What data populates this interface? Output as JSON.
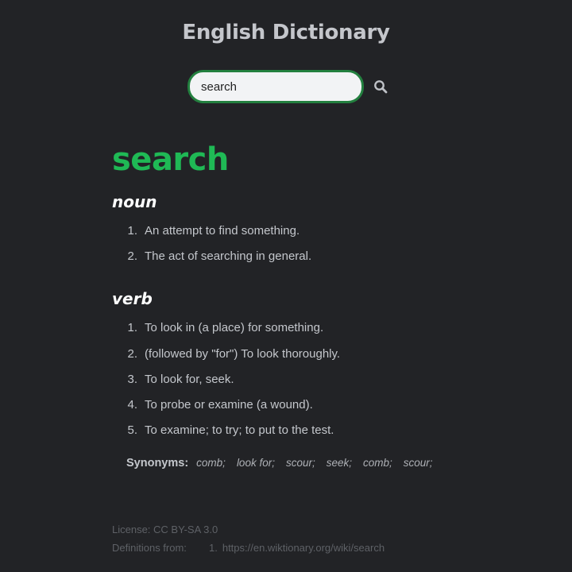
{
  "header": {
    "title": "English Dictionary"
  },
  "search": {
    "value": "search"
  },
  "entry": {
    "word": "search",
    "meanings": [
      {
        "part_of_speech": "noun",
        "definitions": [
          {
            "num": "1.",
            "text": "An attempt to find something."
          },
          {
            "num": "2.",
            "text": "The act of searching in general."
          }
        ]
      },
      {
        "part_of_speech": "verb",
        "definitions": [
          {
            "num": "1.",
            "text": "To look in (a place) for something."
          },
          {
            "num": "2.",
            "text": "(followed by \"for\") To look thoroughly."
          },
          {
            "num": "3.",
            "text": "To look for, seek."
          },
          {
            "num": "4.",
            "text": "To probe or examine (a wound)."
          },
          {
            "num": "5.",
            "text": "To examine; to try; to put to the test."
          }
        ]
      }
    ],
    "synonyms_label": "Synonyms:",
    "synonyms": [
      "comb;",
      "look for;",
      "scour;",
      "seek;",
      "comb;",
      "scour;"
    ]
  },
  "footer": {
    "license": "License: CC BY-SA 3.0",
    "source_label": "Definitions from:",
    "sources": [
      {
        "num": "1.",
        "url": "https://en.wiktionary.org/wiki/search"
      }
    ]
  },
  "colors": {
    "background": "#222326",
    "accent": "#1fb955",
    "input_border": "#23803f"
  },
  "icons": {
    "search_button": "search-icon"
  }
}
